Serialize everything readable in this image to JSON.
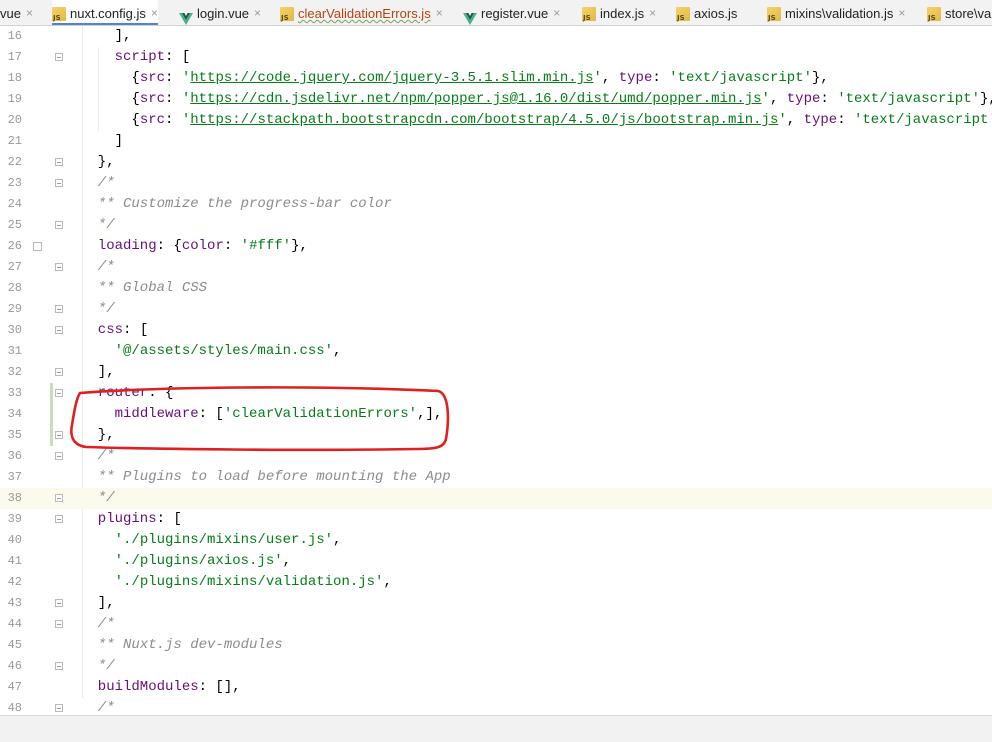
{
  "tabs": [
    {
      "label": "vue",
      "icon": "none",
      "modified": false,
      "active": false,
      "closable": true
    },
    {
      "label": "nuxt.config.js",
      "icon": "js-file-icon",
      "modified": false,
      "active": true,
      "closable": true
    },
    {
      "label": "login.vue",
      "icon": "vue-file-icon",
      "modified": false,
      "active": false,
      "closable": true
    },
    {
      "label": "clearValidationErrors.js",
      "icon": "js-file-icon",
      "modified": true,
      "active": false,
      "closable": true
    },
    {
      "label": "register.vue",
      "icon": "vue-file-icon",
      "modified": false,
      "active": false,
      "closable": true
    },
    {
      "label": "index.js",
      "icon": "js-file-icon",
      "modified": false,
      "active": false,
      "closable": true
    },
    {
      "label": "axios.js",
      "icon": "js-file-icon",
      "modified": false,
      "active": false,
      "closable": false
    },
    {
      "label": "mixins\\validation.js",
      "icon": "js-file-icon",
      "modified": false,
      "active": false,
      "closable": true
    },
    {
      "label": "store\\va",
      "icon": "js-file-icon",
      "modified": false,
      "active": false,
      "closable": false
    }
  ],
  "close_glyph": "×",
  "editor": {
    "current_line": 38,
    "lines": [
      {
        "n": "16",
        "tokens": [
          [
            "n",
            "    ],"
          ]
        ]
      },
      {
        "n": "17",
        "tokens": [
          [
            "n",
            "    "
          ],
          [
            "prop",
            "script"
          ],
          [
            "n",
            ": ["
          ]
        ]
      },
      {
        "n": "18",
        "tokens": [
          [
            "n",
            "      {"
          ],
          [
            "prop",
            "src"
          ],
          [
            "n",
            ": "
          ],
          [
            "s",
            "'"
          ],
          [
            "su",
            "https://code.jquery.com/jquery-3.5.1.slim.min.js"
          ],
          [
            "s",
            "'"
          ],
          [
            "n",
            ", "
          ],
          [
            "prop",
            "type"
          ],
          [
            "n",
            ": "
          ],
          [
            "s",
            "'text/javascript'"
          ],
          [
            "n",
            "},"
          ]
        ]
      },
      {
        "n": "19",
        "tokens": [
          [
            "n",
            "      {"
          ],
          [
            "prop",
            "src"
          ],
          [
            "n",
            ": "
          ],
          [
            "s",
            "'"
          ],
          [
            "su",
            "https://cdn.jsdelivr.net/npm/popper.js@1.16.0/dist/umd/popper.min.js"
          ],
          [
            "s",
            "'"
          ],
          [
            "n",
            ", "
          ],
          [
            "prop",
            "type"
          ],
          [
            "n",
            ": "
          ],
          [
            "s",
            "'text/javascript'"
          ],
          [
            "n",
            "},"
          ]
        ]
      },
      {
        "n": "20",
        "tokens": [
          [
            "n",
            "      {"
          ],
          [
            "prop",
            "src"
          ],
          [
            "n",
            ": "
          ],
          [
            "s",
            "'"
          ],
          [
            "su",
            "https://stackpath.bootstrapcdn.com/bootstrap/4.5.0/js/bootstrap.min.js"
          ],
          [
            "s",
            "'"
          ],
          [
            "n",
            ", "
          ],
          [
            "prop",
            "type"
          ],
          [
            "n",
            ": "
          ],
          [
            "s",
            "'text/javascript'"
          ],
          [
            "n",
            "},"
          ]
        ]
      },
      {
        "n": "21",
        "tokens": [
          [
            "n",
            "    ]"
          ]
        ]
      },
      {
        "n": "22",
        "tokens": [
          [
            "n",
            "  },"
          ]
        ]
      },
      {
        "n": "23",
        "tokens": [
          [
            "c",
            "  /*"
          ]
        ]
      },
      {
        "n": "24",
        "tokens": [
          [
            "c",
            "  ** Customize the progress-bar color"
          ]
        ]
      },
      {
        "n": "25",
        "tokens": [
          [
            "c",
            "  */"
          ]
        ]
      },
      {
        "n": "26",
        "tokens": [
          [
            "prop",
            "  loading"
          ],
          [
            "n",
            ": {"
          ],
          [
            "prop",
            "color"
          ],
          [
            "n",
            ": "
          ],
          [
            "s",
            "'#fff'"
          ],
          [
            "n",
            "},"
          ]
        ]
      },
      {
        "n": "27",
        "tokens": [
          [
            "c",
            "  /*"
          ]
        ]
      },
      {
        "n": "28",
        "tokens": [
          [
            "c",
            "  ** Global CSS"
          ]
        ]
      },
      {
        "n": "29",
        "tokens": [
          [
            "c",
            "  */"
          ]
        ]
      },
      {
        "n": "30",
        "tokens": [
          [
            "prop",
            "  css"
          ],
          [
            "n",
            ": ["
          ]
        ]
      },
      {
        "n": "31",
        "tokens": [
          [
            "n",
            "    "
          ],
          [
            "s",
            "'@/assets/styles/main.css'"
          ],
          [
            "n",
            ","
          ]
        ]
      },
      {
        "n": "32",
        "tokens": [
          [
            "n",
            "  ],"
          ]
        ]
      },
      {
        "n": "33",
        "tokens": [
          [
            "prop",
            "  router"
          ],
          [
            "n",
            ": {"
          ]
        ]
      },
      {
        "n": "34",
        "tokens": [
          [
            "n",
            "    "
          ],
          [
            "prop",
            "middleware"
          ],
          [
            "n",
            ": ["
          ],
          [
            "s",
            "'clearValidationErrors'"
          ],
          [
            "n",
            ",],"
          ]
        ]
      },
      {
        "n": "35",
        "tokens": [
          [
            "n",
            "  },"
          ]
        ]
      },
      {
        "n": "36",
        "tokens": [
          [
            "c",
            "  /*"
          ]
        ]
      },
      {
        "n": "37",
        "tokens": [
          [
            "c",
            "  ** Plugins to load before mounting the App"
          ]
        ]
      },
      {
        "n": "38",
        "tokens": [
          [
            "c",
            "  */"
          ]
        ]
      },
      {
        "n": "39",
        "tokens": [
          [
            "prop",
            "  plugins"
          ],
          [
            "n",
            ": ["
          ]
        ]
      },
      {
        "n": "40",
        "tokens": [
          [
            "n",
            "    "
          ],
          [
            "s",
            "'./plugins/mixins/user.js'"
          ],
          [
            "n",
            ","
          ]
        ]
      },
      {
        "n": "41",
        "tokens": [
          [
            "n",
            "    "
          ],
          [
            "s",
            "'./plugins/axios.js'"
          ],
          [
            "n",
            ","
          ]
        ]
      },
      {
        "n": "42",
        "tokens": [
          [
            "n",
            "    "
          ],
          [
            "s",
            "'./plugins/mixins/validation.js'"
          ],
          [
            "n",
            ","
          ]
        ]
      },
      {
        "n": "43",
        "tokens": [
          [
            "n",
            "  ],"
          ]
        ]
      },
      {
        "n": "44",
        "tokens": [
          [
            "c",
            "  /*"
          ]
        ]
      },
      {
        "n": "45",
        "tokens": [
          [
            "c",
            "  ** Nuxt.js dev-modules"
          ]
        ]
      },
      {
        "n": "46",
        "tokens": [
          [
            "c",
            "  */"
          ]
        ]
      },
      {
        "n": "47",
        "tokens": [
          [
            "prop",
            "  buildModules"
          ],
          [
            "n",
            ": [],"
          ]
        ]
      },
      {
        "n": "48",
        "tokens": [
          [
            "c",
            "  /*"
          ]
        ]
      }
    ]
  },
  "colors": {
    "annotation_red": "#e02020",
    "active_tab_underline": "#4a86c8",
    "string_green": "#067d17",
    "property_purple": "#660e7a",
    "comment_gray": "#8c8c8c",
    "current_line_bg": "#fcfaed",
    "vue_green": "#41b883",
    "vue_dark": "#35495e"
  }
}
